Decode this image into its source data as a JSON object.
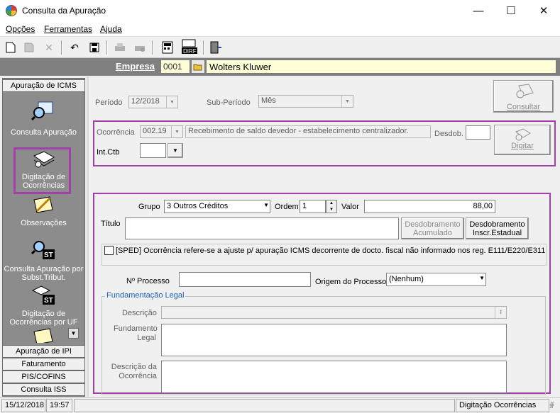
{
  "window": {
    "title": "Consulta da Apuração"
  },
  "menu": [
    "Opções",
    "Ferramentas",
    "Ajuda"
  ],
  "empresa": {
    "label": "Empresa",
    "code": "0001",
    "name": "Wolters Kluwer"
  },
  "nav": {
    "top_header": "Apuração de ICMS",
    "items": [
      "Consulta Apuração",
      "Digitação de Ocorrências",
      "Observações",
      "Consulta Apuração por Subst.Tribut.",
      "Digitação de Ocorrências por UF"
    ],
    "bottom_headers": [
      "Apuração de IPI",
      "Faturamento",
      "PIS/COFINS",
      "Consulta ISS"
    ]
  },
  "form": {
    "periodo_label": "Período",
    "periodo_value": "12/2018",
    "subperiodo_label": "Sub-Período",
    "subperiodo_value": "Mês",
    "consultar_label": "Consultar",
    "ocorrencia_label": "Ocorrência",
    "ocorrencia_code": "002.19",
    "ocorrencia_desc": "Recebimento de saldo devedor - estabelecimento centralizador.",
    "desdob_label": "Desdob.",
    "digitar_label": "Digitar",
    "intctb_label": "Int.Ctb",
    "grupo_label": "Grupo",
    "grupo_value": "3  Outros Créditos",
    "ordem_label": "Ordem",
    "ordem_value": "1",
    "valor_label": "Valor",
    "valor_value": "88,00",
    "titulo_label": "Título",
    "desdob_acum_label": "Desdobramento Acumulado",
    "desdob_inscr_label": "Desdobramento Inscr.Estadual",
    "sped_label": "[SPED] Ocorrência refere-se a ajuste p/ apuração ICMS decorrente de docto. fiscal não informado nos reg. E111/E220/E311",
    "nprocesso_label": "Nº Processo",
    "origem_label": "Origem do Processo",
    "origem_value": "(Nenhum)",
    "fund_group_label": "Fundamentação Legal",
    "descricao_label": "Descrição",
    "fundamento_label": "Fundamento Legal",
    "desc_ocorrencia_label": "Descrição da Ocorrência"
  },
  "status": {
    "date": "15/12/2018",
    "time": "19:57",
    "mode": "Digitação Ocorrências"
  },
  "colors": {
    "highlight": "#a040a8",
    "nav_bg": "#8c8c8c",
    "empresa_bg": "#808080"
  }
}
